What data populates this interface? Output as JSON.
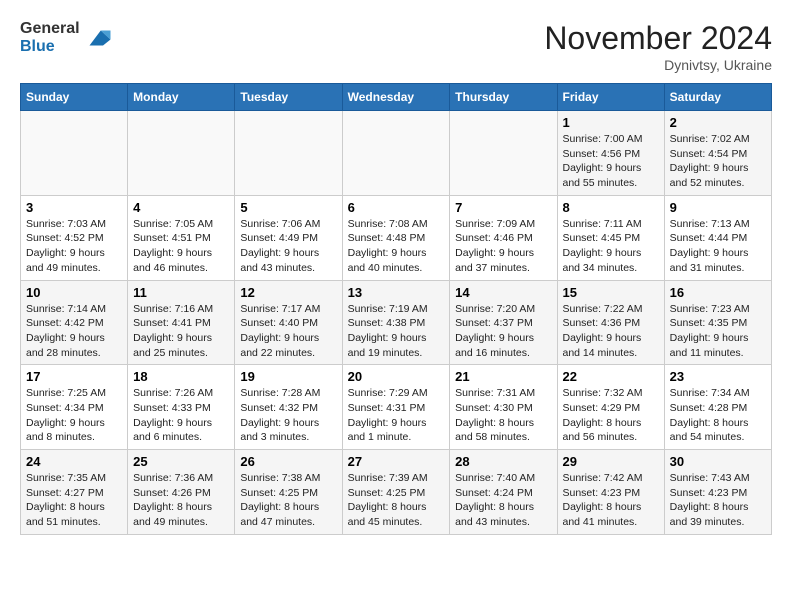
{
  "logo": {
    "line1": "General",
    "line2": "Blue"
  },
  "title": "November 2024",
  "location": "Dynivtsy, Ukraine",
  "days_header": [
    "Sunday",
    "Monday",
    "Tuesday",
    "Wednesday",
    "Thursday",
    "Friday",
    "Saturday"
  ],
  "weeks": [
    [
      {
        "num": "",
        "info": ""
      },
      {
        "num": "",
        "info": ""
      },
      {
        "num": "",
        "info": ""
      },
      {
        "num": "",
        "info": ""
      },
      {
        "num": "",
        "info": ""
      },
      {
        "num": "1",
        "info": "Sunrise: 7:00 AM\nSunset: 4:56 PM\nDaylight: 9 hours and 55 minutes."
      },
      {
        "num": "2",
        "info": "Sunrise: 7:02 AM\nSunset: 4:54 PM\nDaylight: 9 hours and 52 minutes."
      }
    ],
    [
      {
        "num": "3",
        "info": "Sunrise: 7:03 AM\nSunset: 4:52 PM\nDaylight: 9 hours and 49 minutes."
      },
      {
        "num": "4",
        "info": "Sunrise: 7:05 AM\nSunset: 4:51 PM\nDaylight: 9 hours and 46 minutes."
      },
      {
        "num": "5",
        "info": "Sunrise: 7:06 AM\nSunset: 4:49 PM\nDaylight: 9 hours and 43 minutes."
      },
      {
        "num": "6",
        "info": "Sunrise: 7:08 AM\nSunset: 4:48 PM\nDaylight: 9 hours and 40 minutes."
      },
      {
        "num": "7",
        "info": "Sunrise: 7:09 AM\nSunset: 4:46 PM\nDaylight: 9 hours and 37 minutes."
      },
      {
        "num": "8",
        "info": "Sunrise: 7:11 AM\nSunset: 4:45 PM\nDaylight: 9 hours and 34 minutes."
      },
      {
        "num": "9",
        "info": "Sunrise: 7:13 AM\nSunset: 4:44 PM\nDaylight: 9 hours and 31 minutes."
      }
    ],
    [
      {
        "num": "10",
        "info": "Sunrise: 7:14 AM\nSunset: 4:42 PM\nDaylight: 9 hours and 28 minutes."
      },
      {
        "num": "11",
        "info": "Sunrise: 7:16 AM\nSunset: 4:41 PM\nDaylight: 9 hours and 25 minutes."
      },
      {
        "num": "12",
        "info": "Sunrise: 7:17 AM\nSunset: 4:40 PM\nDaylight: 9 hours and 22 minutes."
      },
      {
        "num": "13",
        "info": "Sunrise: 7:19 AM\nSunset: 4:38 PM\nDaylight: 9 hours and 19 minutes."
      },
      {
        "num": "14",
        "info": "Sunrise: 7:20 AM\nSunset: 4:37 PM\nDaylight: 9 hours and 16 minutes."
      },
      {
        "num": "15",
        "info": "Sunrise: 7:22 AM\nSunset: 4:36 PM\nDaylight: 9 hours and 14 minutes."
      },
      {
        "num": "16",
        "info": "Sunrise: 7:23 AM\nSunset: 4:35 PM\nDaylight: 9 hours and 11 minutes."
      }
    ],
    [
      {
        "num": "17",
        "info": "Sunrise: 7:25 AM\nSunset: 4:34 PM\nDaylight: 9 hours and 8 minutes."
      },
      {
        "num": "18",
        "info": "Sunrise: 7:26 AM\nSunset: 4:33 PM\nDaylight: 9 hours and 6 minutes."
      },
      {
        "num": "19",
        "info": "Sunrise: 7:28 AM\nSunset: 4:32 PM\nDaylight: 9 hours and 3 minutes."
      },
      {
        "num": "20",
        "info": "Sunrise: 7:29 AM\nSunset: 4:31 PM\nDaylight: 9 hours and 1 minute."
      },
      {
        "num": "21",
        "info": "Sunrise: 7:31 AM\nSunset: 4:30 PM\nDaylight: 8 hours and 58 minutes."
      },
      {
        "num": "22",
        "info": "Sunrise: 7:32 AM\nSunset: 4:29 PM\nDaylight: 8 hours and 56 minutes."
      },
      {
        "num": "23",
        "info": "Sunrise: 7:34 AM\nSunset: 4:28 PM\nDaylight: 8 hours and 54 minutes."
      }
    ],
    [
      {
        "num": "24",
        "info": "Sunrise: 7:35 AM\nSunset: 4:27 PM\nDaylight: 8 hours and 51 minutes."
      },
      {
        "num": "25",
        "info": "Sunrise: 7:36 AM\nSunset: 4:26 PM\nDaylight: 8 hours and 49 minutes."
      },
      {
        "num": "26",
        "info": "Sunrise: 7:38 AM\nSunset: 4:25 PM\nDaylight: 8 hours and 47 minutes."
      },
      {
        "num": "27",
        "info": "Sunrise: 7:39 AM\nSunset: 4:25 PM\nDaylight: 8 hours and 45 minutes."
      },
      {
        "num": "28",
        "info": "Sunrise: 7:40 AM\nSunset: 4:24 PM\nDaylight: 8 hours and 43 minutes."
      },
      {
        "num": "29",
        "info": "Sunrise: 7:42 AM\nSunset: 4:23 PM\nDaylight: 8 hours and 41 minutes."
      },
      {
        "num": "30",
        "info": "Sunrise: 7:43 AM\nSunset: 4:23 PM\nDaylight: 8 hours and 39 minutes."
      }
    ]
  ]
}
